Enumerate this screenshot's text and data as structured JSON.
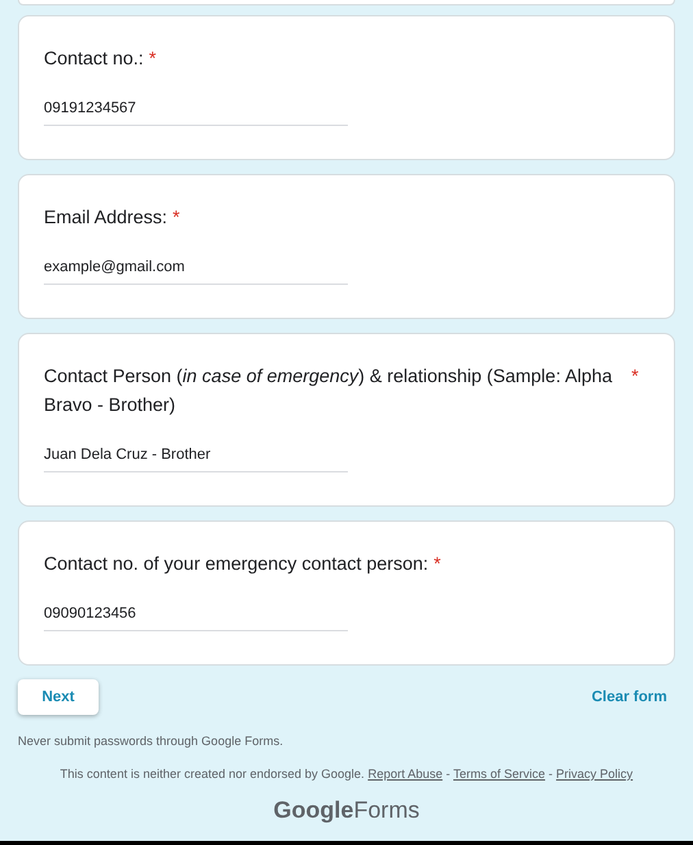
{
  "questions": [
    {
      "title": "Contact no.:",
      "required": true,
      "value": "09191234567"
    },
    {
      "title": "Email Address:",
      "required": true,
      "value": "example@gmail.com"
    },
    {
      "title": "Contact Person (*in case of emergency*) & relationship (Sample: Alpha Bravo - Brother)",
      "required": true,
      "value": "Juan Dela Cruz - Brother"
    },
    {
      "title": "Contact no. of your emergency contact person:",
      "required": true,
      "value": "09090123456"
    }
  ],
  "required_mark": "*",
  "next_button": "Next",
  "clear_link": "Clear form",
  "password_warning": "Never submit passwords through Google Forms.",
  "footer_line": [
    {
      "kind": "text",
      "text": "This content is neither created nor endorsed by Google."
    },
    {
      "kind": "link",
      "text": "Report Abuse"
    },
    {
      "kind": "text",
      "text": "-"
    },
    {
      "kind": "link",
      "text": "Terms of Service"
    },
    {
      "kind": "text",
      "text": "-"
    },
    {
      "kind": "link",
      "text": "Privacy Policy"
    }
  ],
  "logo": {
    "brand": "Google",
    "product": "Forms"
  }
}
